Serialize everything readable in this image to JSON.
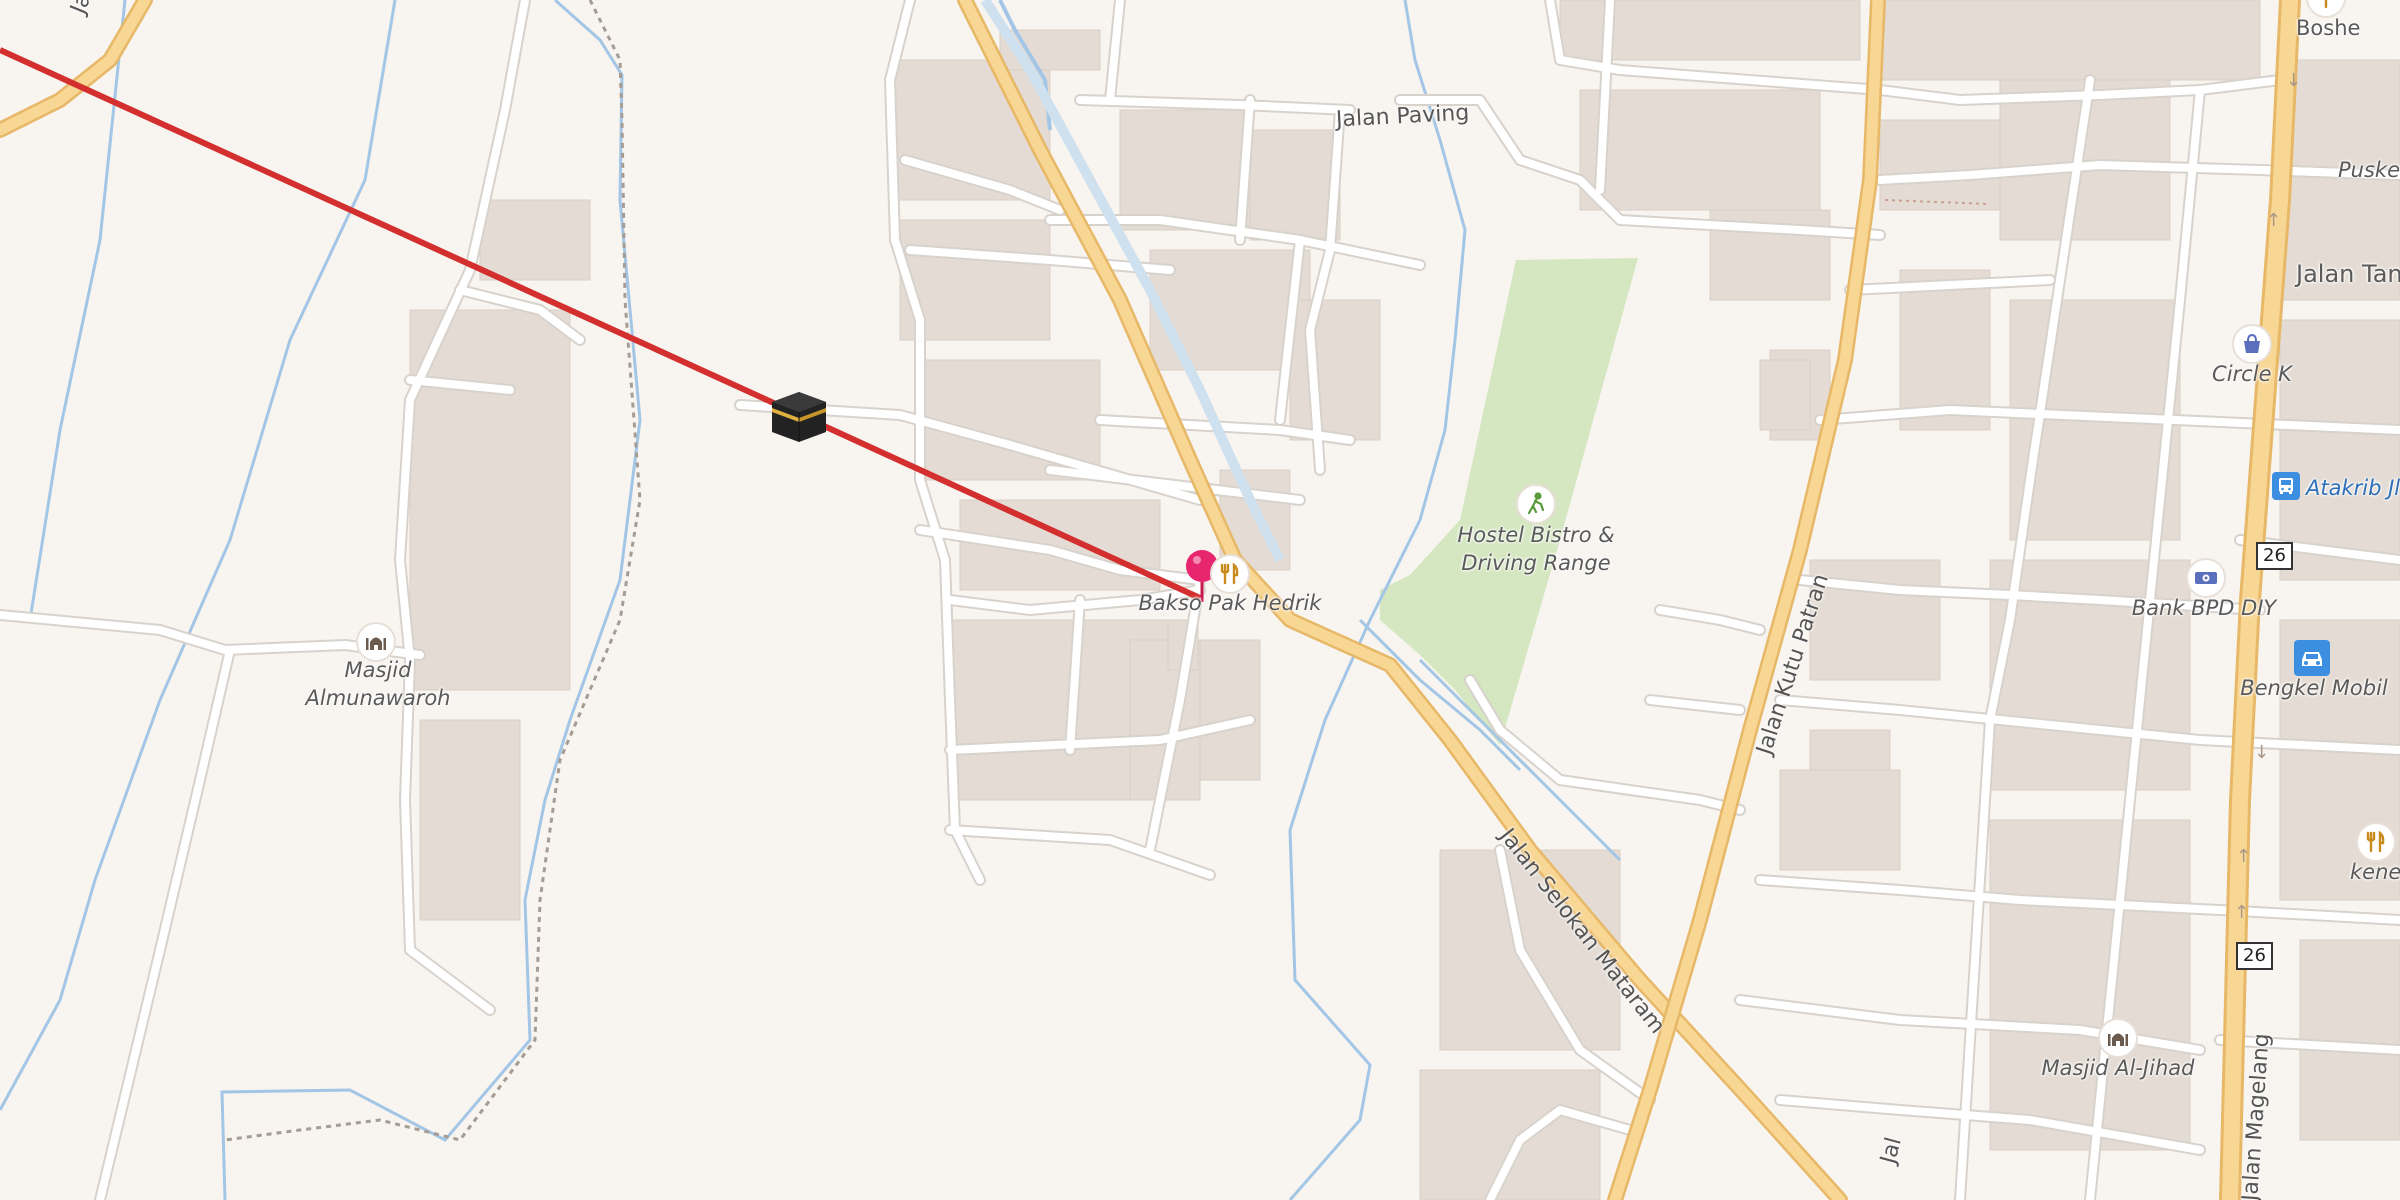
{
  "colors": {
    "background": "#f8f4f0",
    "minor_road": "#ffffff",
    "road_casing": "#d8d2cc",
    "major_road": "#f8d693",
    "major_road_casing": "#e7b868",
    "water": "#a3c6e6",
    "park": "#d4e7c0",
    "building": "#e4dcd4",
    "route_line": "#d32f2f",
    "pin": "#e8256f"
  },
  "icons": {
    "kaaba": "kaaba-icon",
    "pin": "location-pin-icon",
    "restaurant": "fork-knife-icon",
    "mosque": "mosque-icon",
    "golf": "golf-icon",
    "shop": "shopping-bag-icon",
    "bus": "bus-icon",
    "bank": "money-icon",
    "car": "car-icon"
  },
  "labels": {
    "jalan_topleft": "Jalan",
    "jalan_paving": "Jalan Paving",
    "boshe": "Boshe",
    "puskes": "Puskes",
    "jalan_tan": "Jalan Tan",
    "circle_k": "Circle K",
    "atakrib": "Atakrib Jl",
    "hostel_line1": "Hostel Bistro &",
    "hostel_line2": "Driving Range",
    "bakso": "Bakso Pak Hedrik",
    "bank_bpd": "Bank BPD DIY",
    "bengkel": "Bengkel Mobil",
    "kenes": "kenes",
    "masjid_alm_line1": "Masjid",
    "masjid_alm_line2": "Almunawaroh",
    "masjid_aljihad": "Masjid Al-Jihad",
    "jalan_kutu_patran": "Jalan Kutu Patran",
    "jalan_selokan_mataram": "Jalan Selokan Mataram",
    "jalan_magelang": "Jalan Magelang",
    "jal_bottom": "Jal"
  },
  "shields": {
    "upper": "26",
    "lower": "26"
  }
}
